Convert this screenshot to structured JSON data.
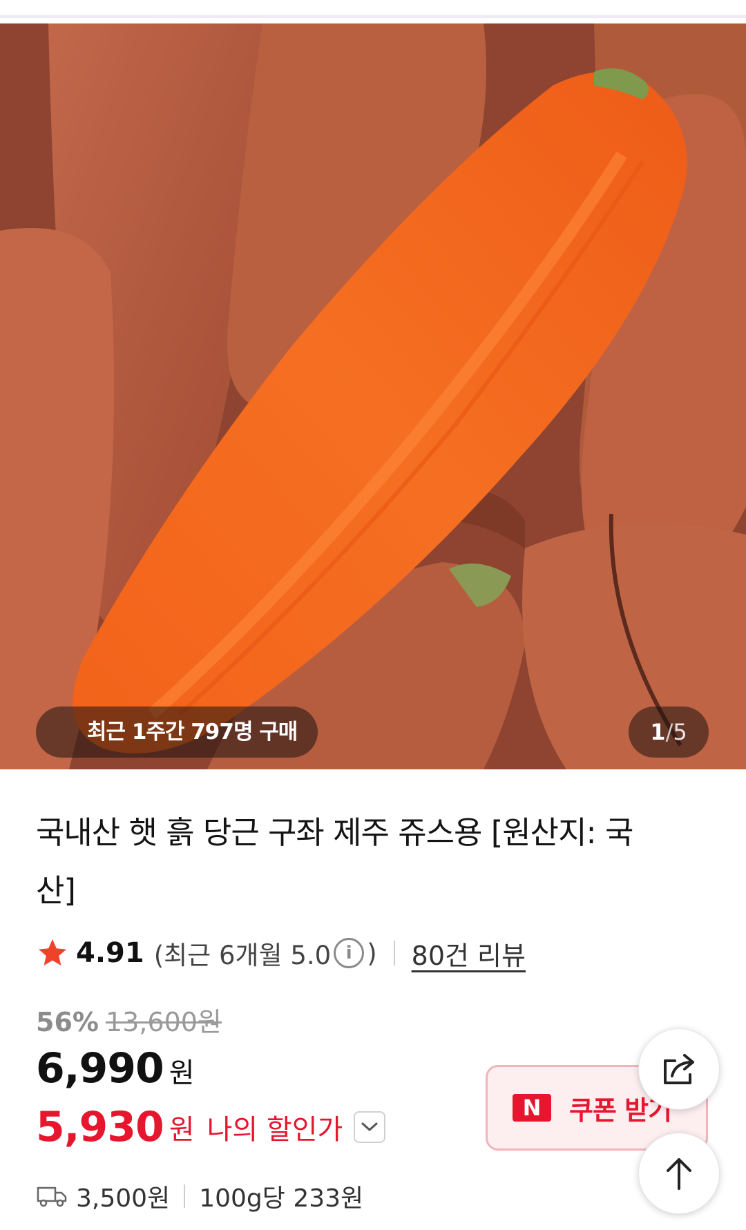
{
  "hero": {
    "purchase_badge": "최근 1주간 797명 구매",
    "page_current": "1",
    "page_separator": "/",
    "page_total": "5"
  },
  "product": {
    "title": "국내산 햇 흙 당근 구좌 제주 쥬스용 [원산지: 국산]",
    "rating": "4.91",
    "recent_open": "(최근 6개월 5.0",
    "recent_close": ")",
    "info_icon_glyph": "i",
    "reviews": "80건 리뷰",
    "discount_rate": "56%",
    "original_price": "13,600원",
    "price": "6,990",
    "price_unit": "원",
    "my_price": "5,930",
    "my_price_unit": "원",
    "my_price_label": "나의 할인가",
    "shipping_fee": "3,500원",
    "unit_price": "100g당 233원"
  },
  "coupon": {
    "badge": "N",
    "label": "쿠폰 받기"
  },
  "icons": {
    "star": "star-icon",
    "info": "info-icon",
    "chevron": "chevron-down-icon",
    "truck": "truck-icon",
    "share": "share-icon",
    "top": "arrow-up-icon"
  },
  "colors": {
    "accent_red": "#e7162f",
    "star_red": "#f0412b",
    "coupon_bg": "#fdeef0",
    "carrot_orange": "#f06a1e"
  }
}
